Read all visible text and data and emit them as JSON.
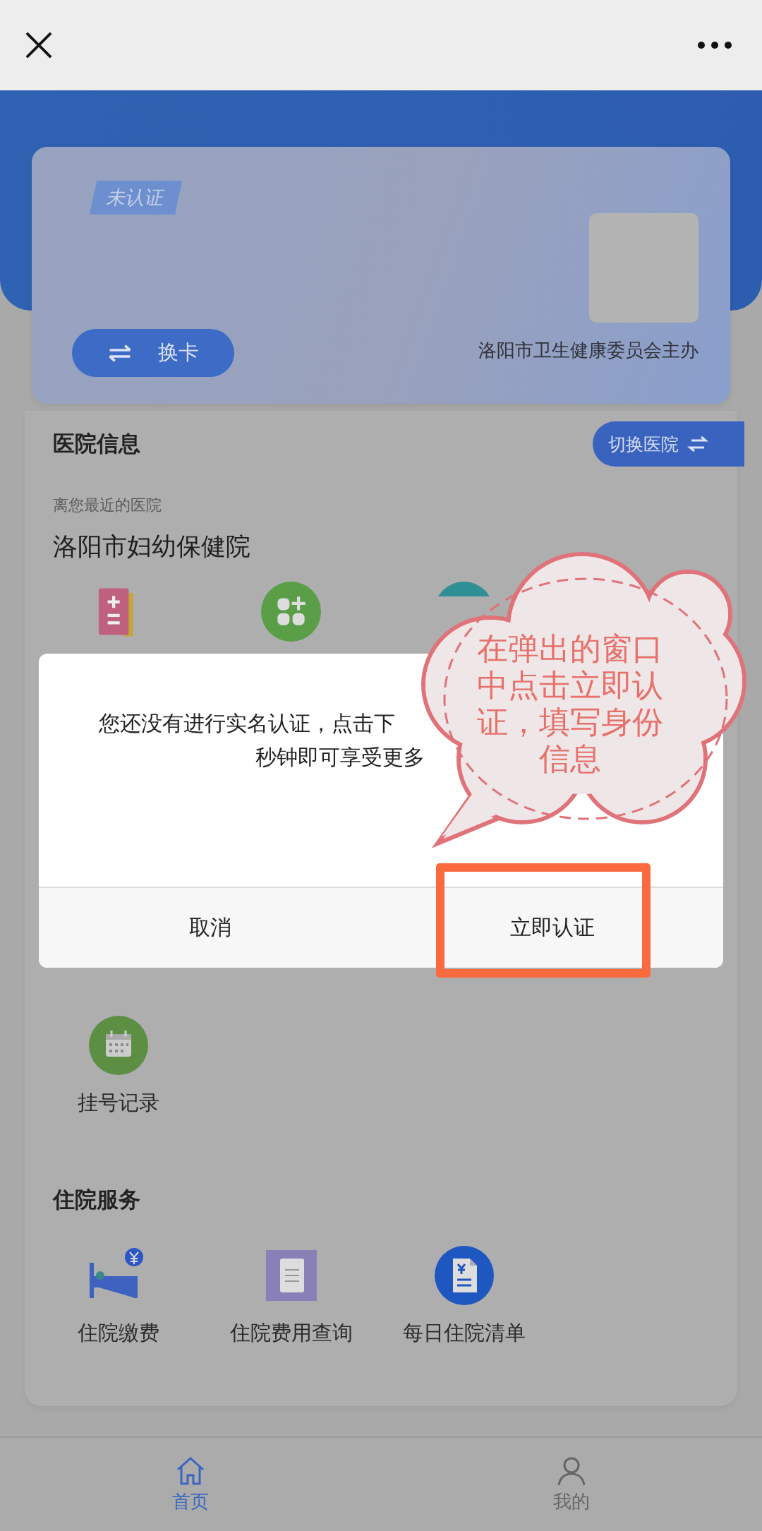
{
  "card": {
    "tag": "未认证",
    "switch_card_button": "换卡",
    "sponsor": "洛阳市卫生健康委员会主办"
  },
  "hospital_section": {
    "title": "医院信息",
    "switch_button": "切换医院",
    "nearest_label": "离您最近的医院",
    "hospital_name": "洛阳市妇幼保健院",
    "services": [
      {
        "kind": "calculator"
      },
      {
        "kind": "clover"
      },
      {
        "kind": "teal"
      }
    ],
    "records": [
      {
        "kind": "calendar",
        "label": "挂号记录"
      }
    ]
  },
  "inpatient": {
    "title": "住院服务",
    "items": [
      {
        "kind": "bed",
        "label": "住院缴费"
      },
      {
        "kind": "notepad",
        "label": "住院费用查询"
      },
      {
        "kind": "bill",
        "label": "每日住院清单"
      }
    ]
  },
  "tab_bar": [
    {
      "kind": "home",
      "label": "首页",
      "selected": true
    },
    {
      "kind": "person",
      "label": "我的",
      "selected": false
    }
  ],
  "dialog": {
    "message_lines": [
      "您还没有进行实名认证，点击下",
      "秒钟即可享受更多"
    ],
    "buttons": [
      "取消",
      "立即认证"
    ]
  },
  "callout": {
    "text": "在弹出的窗口中点击立即认证，填写身份信息"
  }
}
